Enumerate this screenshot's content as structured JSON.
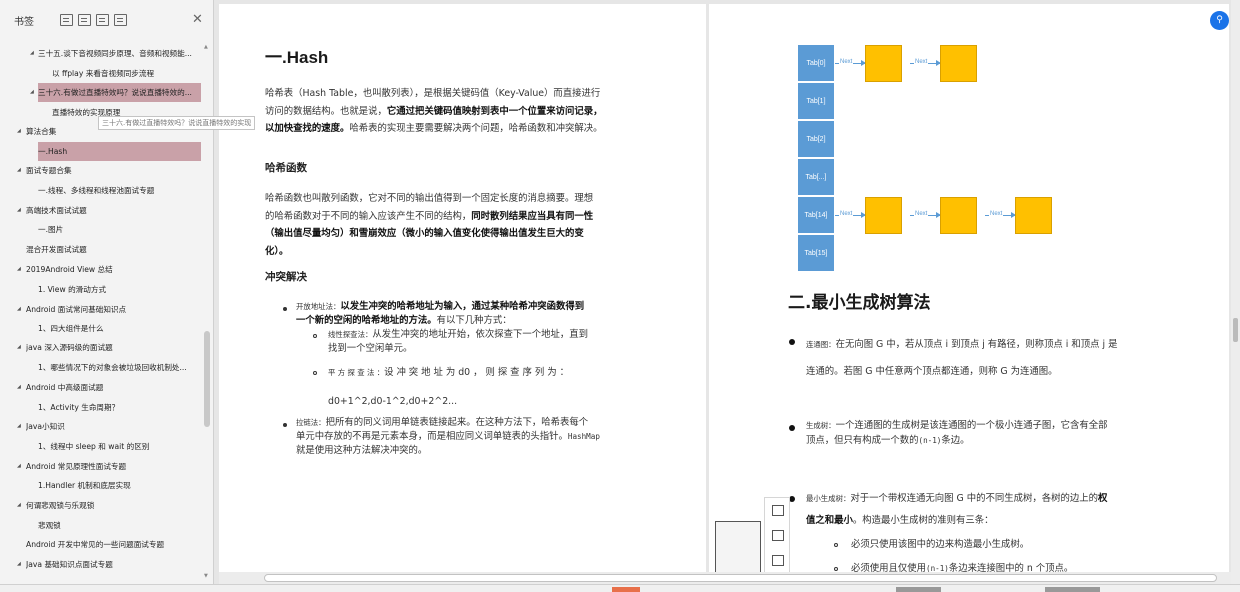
{
  "sidebar": {
    "title": "书签",
    "tooltip": "三十六.有做过直播特效吗？说说直播特效的实现",
    "items": [
      {
        "label": "三十五.谈下音视频同步原理、音频和视频能...",
        "level": 1,
        "caret": "◢"
      },
      {
        "label": "以 ffplay 来看音视频同步流程",
        "level": 2,
        "caret": ""
      },
      {
        "label": "三十六.有做过直播特效吗？说说直播特效的...",
        "level": 1,
        "caret": "◢",
        "selected": true
      },
      {
        "label": "直播特效的实现原理",
        "level": 2,
        "caret": ""
      },
      {
        "label": "算法合集",
        "level": 0,
        "caret": "◢"
      },
      {
        "label": "一.Hash",
        "level": 1,
        "caret": "",
        "selected": true
      },
      {
        "label": "面试专题合集",
        "level": 0,
        "caret": "◢"
      },
      {
        "label": "一.线程、多线程和线程池面试专题",
        "level": 1,
        "caret": ""
      },
      {
        "label": "高端技术面试试题",
        "level": 0,
        "caret": "◢"
      },
      {
        "label": "一.图片",
        "level": 1,
        "caret": ""
      },
      {
        "label": "混合开发面试试题",
        "level": 0,
        "caret": ""
      },
      {
        "label": "2019Android View 总结",
        "level": 0,
        "caret": "◢"
      },
      {
        "label": "1. View 的滑动方式",
        "level": 1,
        "caret": ""
      },
      {
        "label": "Android 面试常问基础知识点",
        "level": 0,
        "caret": "◢"
      },
      {
        "label": "1、四大组件是什么",
        "level": 1,
        "caret": ""
      },
      {
        "label": "java 深入源码级的面试题",
        "level": 0,
        "caret": "◢"
      },
      {
        "label": "1、哪些情况下的对象会被垃圾回收机制处...",
        "level": 1,
        "caret": ""
      },
      {
        "label": "Android 中高级面试题",
        "level": 0,
        "caret": "◢"
      },
      {
        "label": "1、Activity 生命周期？",
        "level": 1,
        "caret": ""
      },
      {
        "label": "Java小知识",
        "level": 0,
        "caret": "◢"
      },
      {
        "label": "1、线程中 sleep 和 wait 的区别",
        "level": 1,
        "caret": ""
      },
      {
        "label": "Android 常见原理性面试专题",
        "level": 0,
        "caret": "◢"
      },
      {
        "label": "1.Handler 机制和底层实现",
        "level": 1,
        "caret": ""
      },
      {
        "label": "何谓悲观锁与乐观锁",
        "level": 0,
        "caret": "◢"
      },
      {
        "label": "悲观锁",
        "level": 1,
        "caret": ""
      },
      {
        "label": "Android 开发中常见的一些问题面试专题",
        "level": 0,
        "caret": ""
      },
      {
        "label": "Java 基础知识点面试专题",
        "level": 0,
        "caret": "◢"
      }
    ]
  },
  "left_page": {
    "h1_num": "一",
    "h1_text": ".Hash",
    "intro_1": "哈希表（Hash Table，也叫散列表），是根据关键码值（Key-Value）而直接进行",
    "intro_2a": "访问的数据结构。也就是说，",
    "intro_2b": "它通过把关键码值映射到表中一个位置来访问记录，",
    "intro_3a": "以加快查找的速度。",
    "intro_3b": "哈希表的实现主要需要解决两个问题，哈希函数和冲突解决。",
    "h_func": "哈希函数",
    "func_1": "哈希函数也叫散列函数，它对不同的输出值得到一个固定长度的消息摘要。理想",
    "func_2a": "的哈希函数对于不同的输入应该产生不同的结构，",
    "func_2b": "同时散列结果应当具有同一性",
    "func_3": "（输出值尽量均匀）和雪崩效应（微小的输入值变化使得输出值发生巨大的变",
    "func_4": "化）。",
    "h_conflict": "冲突解决",
    "b1_label": "开放地址法：",
    "b1_bold1": "以发生冲突的哈希地址为输入，通过某种哈希冲突函数得到",
    "b1_bold2": "一个新的空闲的哈希地址的方法。",
    "b1_tail": "有以下几种方式：",
    "s1_label": "线性探查法：",
    "s1_text1": "从发生冲突的地址开始，依次探查下一个地址，直到",
    "s1_text2": "找到一个空闲单元。",
    "s2_label": "平 方 探 查 法 ：",
    "s2_text": "设 冲 突 地 址 为  d0 ， 则 探 查 序 列 为 ：",
    "s2_seq": "d0+1^2,d0-1^2,d0+2^2...",
    "b2_label": "拉链法：",
    "b2_text1": "把所有的同义词用单链表链接起来。在这种方法下，哈希表每个",
    "b2_text2": "单元中存放的不再是元素本身，而是相应同义词单链表的头指针。",
    "b2_code": "HashMap",
    "b2_text3": "就是使用这种方法解决冲突的。"
  },
  "diagram": {
    "tabs": [
      "Tab[0]",
      "Tab[1]",
      "Tab[2]",
      "Tab[...]",
      "Tab[14]",
      "Tab[15]"
    ],
    "next_label": "Next",
    "tab_color": "#5b9bd5",
    "node_color": "#ffc000"
  },
  "right_page": {
    "h1_num": "二",
    "h1_text": ".最小生成树算法",
    "c1_label": "连通图：",
    "c1_text1": "在无向图 G 中，若从顶点 i 到顶点 j 有路径，则称顶点 i 和顶点 j 是",
    "c1_text2": "连通的。若图 G 中任意两个顶点都连通，则称 G 为连通图。",
    "c2_label": "生成树：",
    "c2_text1": "一个连通图的生成树是该连通图的一个极小连通子图，它含有全部",
    "c2_text2a": "顶点，但只有构成一个数的",
    "c2_code": "(n-1)",
    "c2_text2b": "条边。",
    "c3_label": "最小生成树：",
    "c3_text1a": "对于一个带权连通无向图 G 中的不同生成树，各树的边上的",
    "c3_text1b": "权",
    "c3_text2a": "值之和最小",
    "c3_text2b": "。构造最小生成树的准则有三条：",
    "r1": "必须只使用该图中的边来构造最小生成树。",
    "r2a": "必须使用且仅使用",
    "r2_code": "(n-1)",
    "r2b": "条边来连接图中的 n 个顶点。"
  },
  "floating": {
    "icons": [
      "image-icon",
      "note-icon",
      "table-icon"
    ]
  }
}
